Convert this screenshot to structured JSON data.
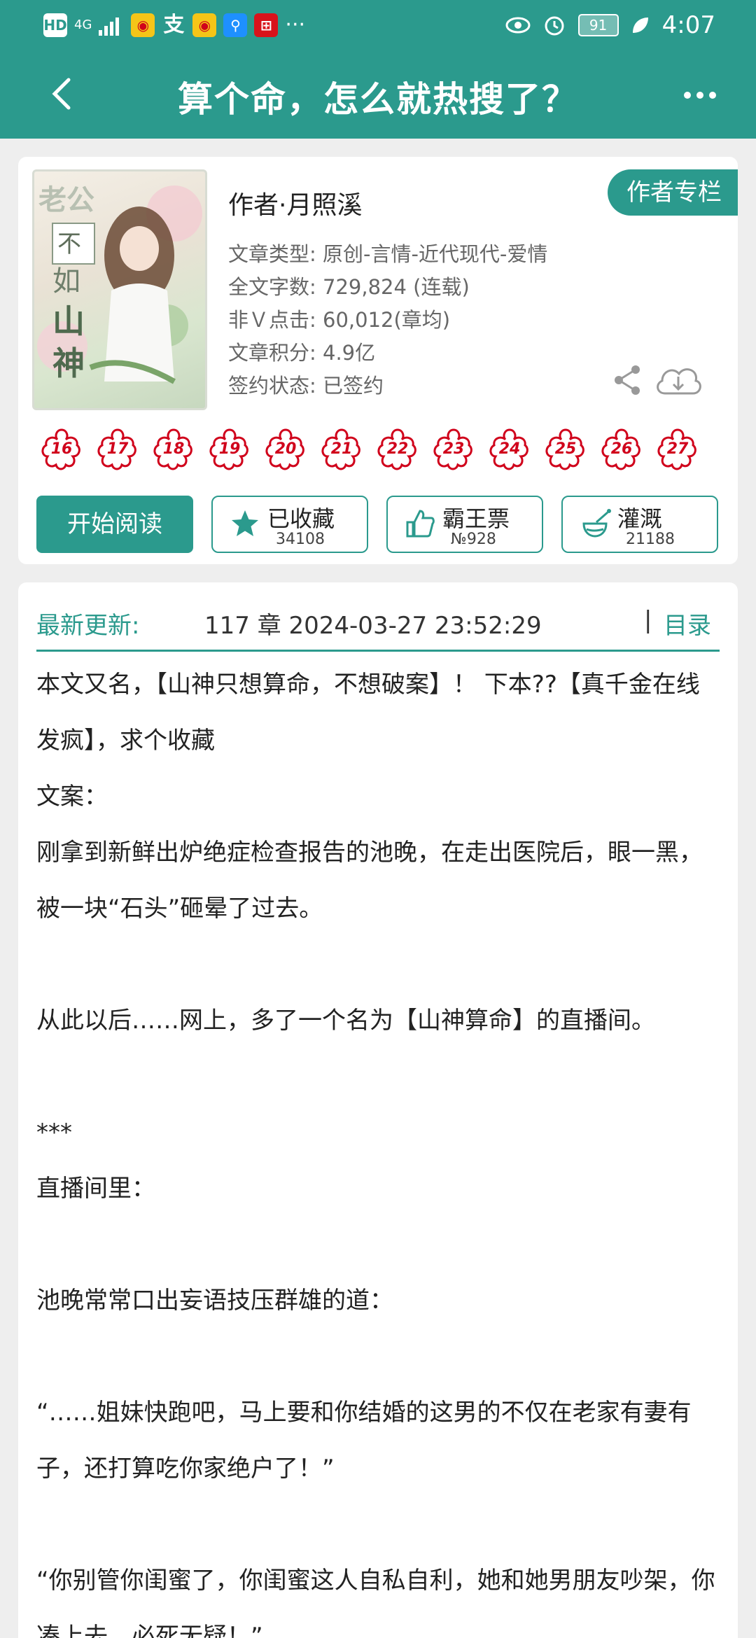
{
  "status_bar": {
    "left_icons": [
      "HD",
      "4G",
      "signal-icon",
      "weibo-icon",
      "alipay-icon",
      "weibo-icon",
      "search-app-icon",
      "shop-app-icon",
      "..."
    ],
    "hd": "HD",
    "network": "4G",
    "more": "···",
    "battery": "91",
    "time": "4:07"
  },
  "header": {
    "title": "算个命，怎么就热搜了？"
  },
  "book": {
    "author": "作者·月照溪",
    "author_column_button": "作者专栏",
    "meta": [
      {
        "label": "文章类型: ",
        "value": "原创-言情-近代现代-爱情"
      },
      {
        "label": "全文字数: ",
        "value": "729,824 (连载)"
      },
      {
        "label": "非Ｖ点击: ",
        "value": "60,012(章均)"
      },
      {
        "label": "文章积分: ",
        "value": "4.9亿"
      },
      {
        "label": "签约状态: ",
        "value": "已签约"
      }
    ],
    "badges": [
      "16",
      "17",
      "18",
      "19",
      "20",
      "21",
      "22",
      "23",
      "24",
      "25",
      "26",
      "27"
    ],
    "actions": {
      "start": "开始阅读",
      "collect": {
        "label": "已收藏",
        "count": "34108"
      },
      "ticket": {
        "label": "霸王票",
        "count": "№928"
      },
      "water": {
        "label": "灌溉",
        "count": "21188"
      }
    }
  },
  "latest": {
    "label": "最新更新:",
    "info": "117 章  2024-03-27 23:52:29",
    "divider": "|",
    "toc": "目录"
  },
  "content": [
    "本文又名，【山神只想算命，不想破案】！ 下本??【真千金在线发疯】，求个收藏",
    "文案：",
    "刚拿到新鲜出炉绝症检查报告的池晚，在走出医院后，眼一黑，被一块“石头”砸晕了过去。",
    "",
    "从此以后……网上，多了一个名为【山神算命】的直播间。",
    "",
    "***",
    "直播间里：",
    "",
    "池晚常常口出妄语技压群雄的道：",
    "",
    "“……姐妹快跑吧，马上要和你结婚的这男的不仅在老家有妻有子，还打算吃你家绝户了！”",
    "",
    "“你别管你闺蜜了，你闺蜜这人自私自利，她和她男朋友吵架，你凑上去，必死无疑！”"
  ],
  "colors": {
    "accent": "#2b9a8d",
    "badge_red": "#d0021b"
  }
}
